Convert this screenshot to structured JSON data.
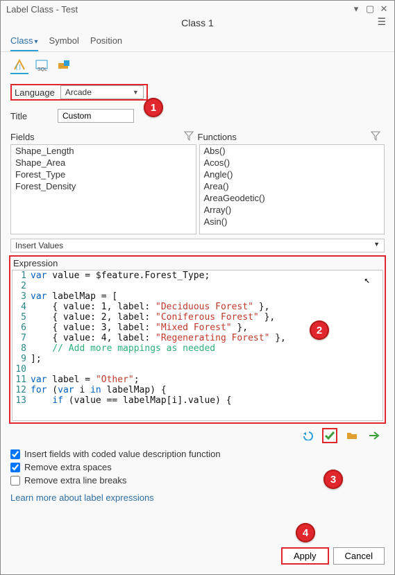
{
  "titlebar": {
    "title": "Label Class - Test"
  },
  "classname": "Class 1",
  "tabs": {
    "class": "Class",
    "symbol": "Symbol",
    "position": "Position"
  },
  "language": {
    "label": "Language",
    "value": "Arcade"
  },
  "titlefield": {
    "label": "Title",
    "value": "Custom"
  },
  "sections": {
    "fields": "Fields",
    "functions": "Functions"
  },
  "fields": [
    "Shape_Length",
    "Shape_Area",
    "Forest_Type",
    "Forest_Density"
  ],
  "functions": [
    "Abs()",
    "Acos()",
    "Angle()",
    "Area()",
    "AreaGeodetic()",
    "Array()",
    "Asin()"
  ],
  "insertvalues": "Insert Values",
  "expression": {
    "label": "Expression",
    "code": [
      {
        "n": 1,
        "pre": "",
        "t": [
          [
            "kwd",
            "var"
          ],
          [
            "ident",
            " value = $feature.Forest_Type;"
          ]
        ]
      },
      {
        "n": 2,
        "pre": "",
        "t": []
      },
      {
        "n": 3,
        "pre": "",
        "t": [
          [
            "kwd",
            "var"
          ],
          [
            "ident",
            " labelMap = ["
          ]
        ]
      },
      {
        "n": 4,
        "pre": "    ",
        "t": [
          [
            "ident",
            "{ value: 1, label: "
          ],
          [
            "str",
            "\"Deciduous Forest\""
          ],
          [
            "ident",
            " },"
          ]
        ]
      },
      {
        "n": 5,
        "pre": "    ",
        "t": [
          [
            "ident",
            "{ value: 2, label: "
          ],
          [
            "str",
            "\"Coniferous Forest\""
          ],
          [
            "ident",
            " },"
          ]
        ]
      },
      {
        "n": 6,
        "pre": "    ",
        "t": [
          [
            "ident",
            "{ value: 3, label: "
          ],
          [
            "str",
            "\"Mixed Forest\""
          ],
          [
            "ident",
            " },"
          ]
        ]
      },
      {
        "n": 7,
        "pre": "    ",
        "t": [
          [
            "ident",
            "{ value: 4, label: "
          ],
          [
            "str",
            "\"Regenerating Forest\""
          ],
          [
            "ident",
            " },"
          ]
        ]
      },
      {
        "n": 8,
        "pre": "    ",
        "t": [
          [
            "cmt",
            "// Add more mappings as needed"
          ]
        ]
      },
      {
        "n": 9,
        "pre": "",
        "t": [
          [
            "ident",
            "];"
          ]
        ]
      },
      {
        "n": 10,
        "pre": "",
        "t": []
      },
      {
        "n": 11,
        "pre": "",
        "t": [
          [
            "kwd",
            "var"
          ],
          [
            "ident",
            " label = "
          ],
          [
            "str",
            "\"Other\""
          ],
          [
            "ident",
            ";"
          ]
        ]
      },
      {
        "n": 12,
        "pre": "",
        "t": [
          [
            "kwd",
            "for"
          ],
          [
            "ident",
            " ("
          ],
          [
            "kwd",
            "var"
          ],
          [
            "ident",
            " i "
          ],
          [
            "kwd",
            "in"
          ],
          [
            "ident",
            " labelMap) {"
          ]
        ]
      },
      {
        "n": 13,
        "pre": "    ",
        "t": [
          [
            "kwd",
            "if"
          ],
          [
            "ident",
            " (value == labelMap[i].value) {"
          ]
        ]
      }
    ]
  },
  "checks": {
    "coded": "Insert fields with coded value description function",
    "spaces": "Remove extra spaces",
    "breaks": "Remove extra line breaks"
  },
  "link": "Learn more about label expressions",
  "buttons": {
    "apply": "Apply",
    "cancel": "Cancel"
  },
  "callouts": {
    "c1": "1",
    "c2": "2",
    "c3": "3",
    "c4": "4"
  }
}
